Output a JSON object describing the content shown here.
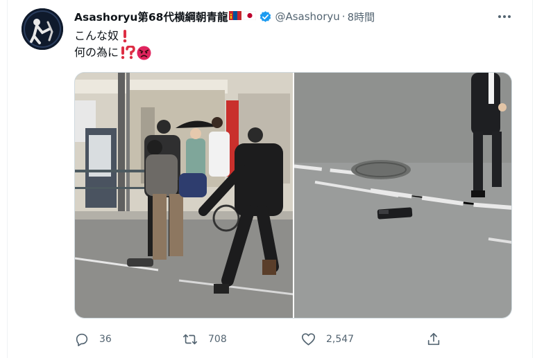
{
  "tweet": {
    "display_name": "Asashoryu第68代横綱朝青龍",
    "flags": [
      "mongolia-flag",
      "japan-flag"
    ],
    "verified": true,
    "handle": "@Asashoryu",
    "separator": "·",
    "time": "8時間",
    "text_lines": [
      "こんな奴",
      "何の為に"
    ],
    "text_emojis": [
      "red-exclamation-icon",
      "exclamation-question-icon",
      "angry-face-icon"
    ],
    "media": [
      "street-scene-photo",
      "road-object-photo"
    ],
    "actions": {
      "reply_count": "36",
      "retweet_count": "708",
      "like_count": "2,547"
    }
  },
  "colors": {
    "text": "#0f1419",
    "secondary": "#536471",
    "verified": "#1d9bf0",
    "border": "#eff3f4"
  }
}
